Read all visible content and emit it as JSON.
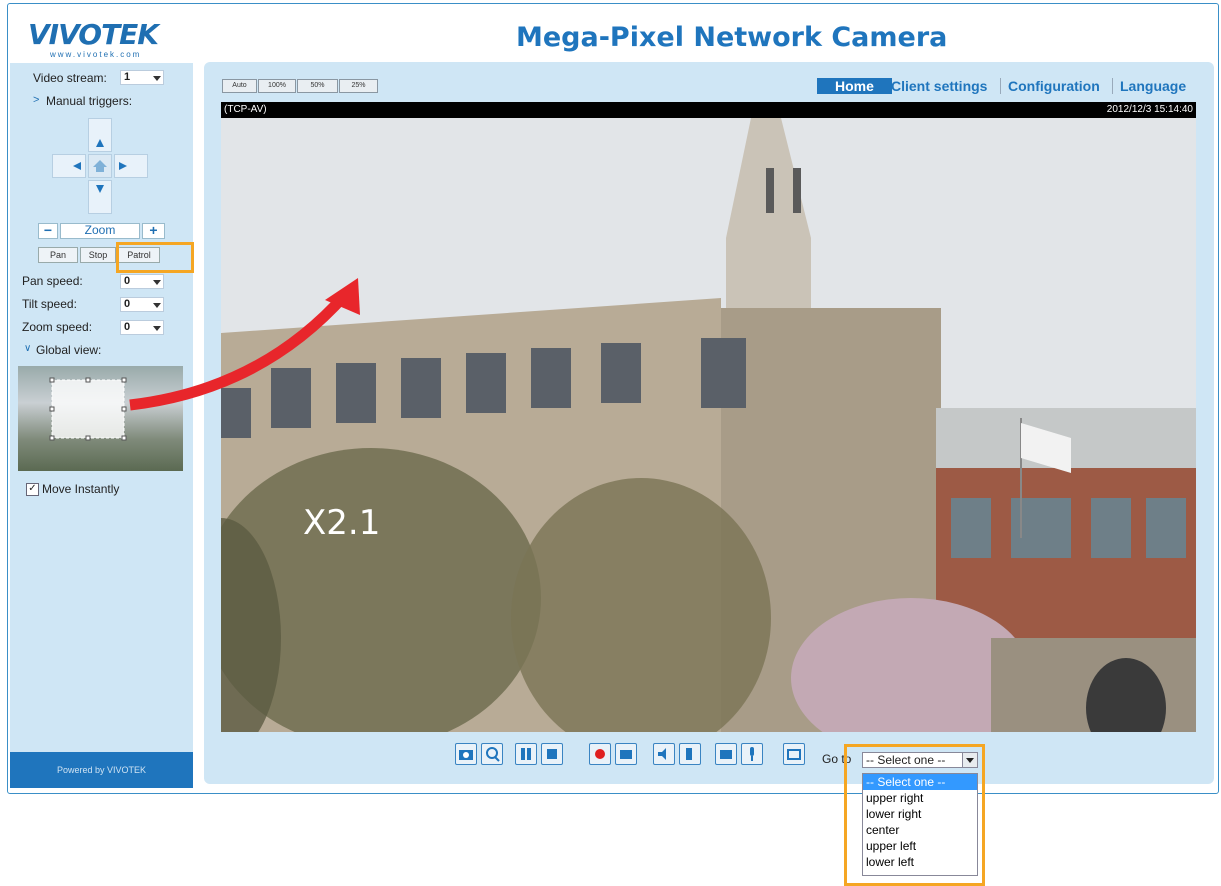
{
  "header": {
    "logo_text": "VIVOTEK",
    "logo_sub": "www.vivotek.com",
    "title": "Mega-Pixel Network Camera"
  },
  "sidebar": {
    "video_stream_label": "Video stream:",
    "video_stream_value": "1",
    "manual_triggers_label": "Manual triggers:",
    "zoom_label": "Zoom",
    "zoom_minus": "−",
    "zoom_plus": "+",
    "pan_button": "Pan",
    "stop_button": "Stop",
    "patrol_button": "Patrol",
    "pan_speed_label": "Pan speed:",
    "pan_speed_value": "0",
    "tilt_speed_label": "Tilt speed:",
    "tilt_speed_value": "0",
    "zoom_speed_label": "Zoom speed:",
    "zoom_speed_value": "0",
    "global_view_label": "Global view:",
    "move_instantly_label": "Move Instantly",
    "move_instantly_checked": true,
    "powered_by": "Powered by VIVOTEK"
  },
  "view_size_buttons": [
    "Auto",
    "100%",
    "50%",
    "25%"
  ],
  "nav": {
    "home": "Home",
    "client_settings": "Client settings",
    "configuration": "Configuration",
    "language": "Language"
  },
  "video": {
    "protocol": "(TCP-AV)",
    "timestamp": "2012/12/3 15:14:40",
    "zoom_overlay": "X2.1"
  },
  "toolbar_icons": [
    "camera-snapshot-icon",
    "digital-zoom-icon",
    "pause-icon",
    "stop-icon",
    "record-icon",
    "manual-trigger-icon",
    "volume-icon",
    "talk-icon",
    "upload-icon",
    "microphone-icon",
    "fullscreen-icon"
  ],
  "goto": {
    "label": "Go to",
    "selected": "-- Select one --",
    "options": [
      "-- Select one --",
      "upper right",
      "lower right",
      "center",
      "upper left",
      "lower left"
    ]
  },
  "colors": {
    "accent": "#1f75bd",
    "panel": "#cfe6f5",
    "highlight": "#f5a623",
    "arrow": "#e8262b"
  }
}
